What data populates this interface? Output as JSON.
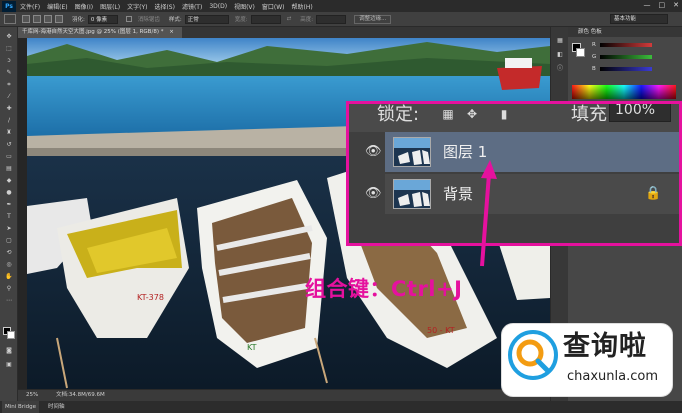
{
  "menubar": {
    "app_logo": "Ps",
    "items": [
      "文件(F)",
      "编辑(E)",
      "图像(I)",
      "图层(L)",
      "文字(Y)",
      "选择(S)",
      "滤镜(T)",
      "3D(D)",
      "视图(V)",
      "窗口(W)",
      "帮助(H)"
    ],
    "window_controls": [
      "—",
      "□",
      "✕"
    ]
  },
  "optionsbar": {
    "feather_label": "羽化:",
    "feather_value": "0 像素",
    "antialias_label": "消除锯齿",
    "style_label": "样式:",
    "style_value": "正常",
    "width_label": "宽度:",
    "height_label": "高度:",
    "refine_button": "调整边缘...",
    "workspace": "基本功能"
  },
  "document": {
    "tab_title": "千库网-海港自然天空大图.jpg @ 25% (图层 1, RGB/8) *",
    "tab_close": "×"
  },
  "statusbar": {
    "zoom": "25%",
    "doc_size": "文档:34.8M/69.6M"
  },
  "bottombar": {
    "tab1": "Mini Bridge",
    "tab2": "时间轴"
  },
  "color_panel": {
    "tabs": "颜色   色板",
    "r": "R",
    "g": "G",
    "b": "B",
    "r_color": "#d33b3b",
    "g_color": "#3bbd3b",
    "b_color": "#3b3bd3"
  },
  "layers_zoom": {
    "lock_label": "锁定:",
    "fill_label": "填充:",
    "opacity_value": "100%",
    "layers": [
      {
        "name": "图层 1",
        "selected": true
      },
      {
        "name": "背景",
        "locked": true
      }
    ]
  },
  "annotation": {
    "shortcut": "组合键：Ctrl+J",
    "accent_color": "#e5119e"
  },
  "watermark": {
    "brand_cn": "查询啦",
    "brand_url": "chaxunla.com"
  }
}
